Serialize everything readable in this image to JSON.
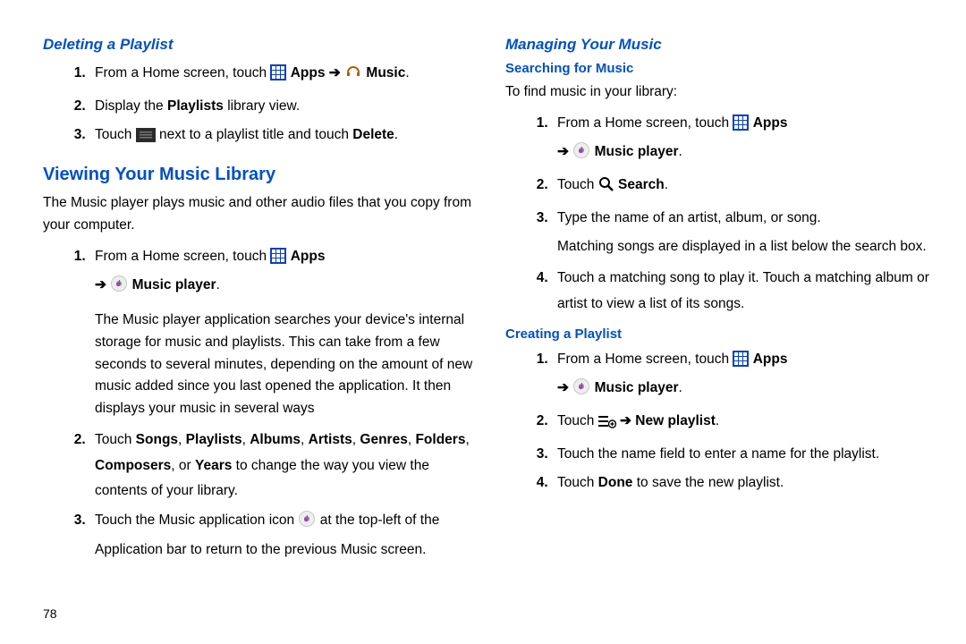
{
  "page_number": "78",
  "left": {
    "h1": "Deleting a Playlist",
    "ol1": {
      "i1a": "From a Home screen, touch ",
      "i1b": "Apps",
      "i1c": "Music",
      "i2a": "Display the ",
      "i2b": "Playlists",
      "i2c": " library view.",
      "i3a": "Touch ",
      "i3b": " next to a playlist title and touch ",
      "i3c": "Delete"
    },
    "h2": "Viewing Your Music Library",
    "p1": "The Music player plays music and other audio files that you copy from your computer.",
    "ol2": {
      "i1a": "From a Home screen, touch ",
      "i1b": "Apps",
      "i1c": "Music player",
      "i1d": "The Music player application searches your device's internal storage for music and playlists. This can take from a few seconds to several minutes, depending on the amount of new music added since you last opened the application. It then displays your music in several ways",
      "i2a": "Touch ",
      "i2b": "Songs",
      "i2c": "Playlists",
      "i2d": "Albums",
      "i2e": "Artists",
      "i2f": "Genres",
      "i2g": "Folders",
      "i2h": "Composers",
      "i2i": "Years",
      "i2j": " to change the way you view the contents of your library.",
      "i3a": "Touch the Music application icon ",
      "i3b": " at the top-left of the Application bar to return to the previous Music screen."
    }
  },
  "right": {
    "h1": "Managing Your Music",
    "h2": "Searching for Music",
    "p1": "To find music in your library:",
    "ol1": {
      "i1a": "From a Home screen, touch ",
      "i1b": "Apps",
      "i1c": "Music player",
      "i2a": "Touch ",
      "i2b": "Search",
      "i3a": "Type the name of an artist, album, or song.",
      "i3b": "Matching songs are displayed in a list below the search box.",
      "i4a": "Touch a matching song to play it. Touch a matching album or artist to view a list of its songs."
    },
    "h3": "Creating a Playlist",
    "ol2": {
      "i1a": "From a Home screen, touch ",
      "i1b": "Apps",
      "i1c": "Music player",
      "i2a": "Touch ",
      "i2b": "New playlist",
      "i3a": "Touch the name field to enter a name for the playlist.",
      "i4a": "Touch ",
      "i4b": "Done",
      "i4c": " to save the new playlist."
    }
  }
}
